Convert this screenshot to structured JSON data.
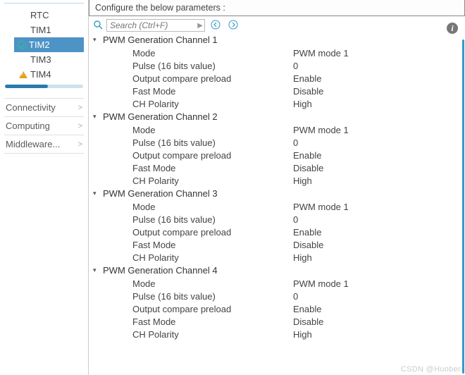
{
  "sidebar": {
    "tree": [
      {
        "label": "RTC",
        "status": ""
      },
      {
        "label": "TIM1",
        "status": ""
      },
      {
        "label": "TIM2",
        "status": "check",
        "selected": true
      },
      {
        "label": "TIM3",
        "status": ""
      },
      {
        "label": "TIM4",
        "status": "warn"
      }
    ],
    "categories": [
      {
        "label": "Connectivity"
      },
      {
        "label": "Computing"
      },
      {
        "label": "Middleware..."
      }
    ]
  },
  "header": {
    "text": "Configure the below parameters :"
  },
  "search": {
    "placeholder": "Search (Ctrl+F)"
  },
  "info_glyph": "i",
  "groups": [
    {
      "title": "PWM Generation Channel 1",
      "rows": [
        {
          "label": "Mode",
          "value": "PWM mode 1"
        },
        {
          "label": "Pulse (16 bits value)",
          "value": "0"
        },
        {
          "label": "Output compare preload",
          "value": "Enable"
        },
        {
          "label": "Fast Mode",
          "value": "Disable"
        },
        {
          "label": "CH Polarity",
          "value": "High"
        }
      ]
    },
    {
      "title": "PWM Generation Channel 2",
      "rows": [
        {
          "label": "Mode",
          "value": "PWM mode 1"
        },
        {
          "label": "Pulse (16 bits value)",
          "value": "0"
        },
        {
          "label": "Output compare preload",
          "value": "Enable"
        },
        {
          "label": "Fast Mode",
          "value": "Disable"
        },
        {
          "label": "CH Polarity",
          "value": "High"
        }
      ]
    },
    {
      "title": "PWM Generation Channel 3",
      "rows": [
        {
          "label": "Mode",
          "value": "PWM mode 1"
        },
        {
          "label": "Pulse (16 bits value)",
          "value": "0"
        },
        {
          "label": "Output compare preload",
          "value": "Enable"
        },
        {
          "label": "Fast Mode",
          "value": "Disable"
        },
        {
          "label": "CH Polarity",
          "value": "High"
        }
      ]
    },
    {
      "title": "PWM Generation Channel 4",
      "rows": [
        {
          "label": "Mode",
          "value": "PWM mode 1"
        },
        {
          "label": "Pulse (16 bits value)",
          "value": "0"
        },
        {
          "label": "Output compare preload",
          "value": "Enable"
        },
        {
          "label": "Fast Mode",
          "value": "Disable"
        },
        {
          "label": "CH Polarity",
          "value": "High"
        }
      ]
    }
  ],
  "watermark": "CSDN @Huober"
}
